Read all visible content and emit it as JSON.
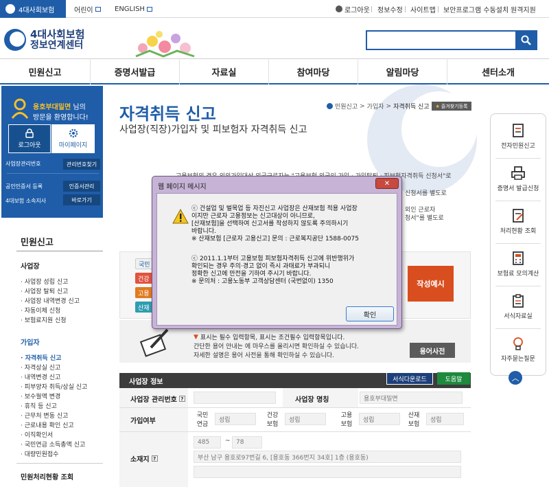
{
  "topbar": {
    "active_tab": "4대사회보험",
    "tabs": [
      "어린이",
      "ENGLISH"
    ],
    "links": [
      "로그아웃",
      "정보수정",
      "사이트맵",
      "보안프로그램 수동설치",
      "원격지원"
    ]
  },
  "header": {
    "logo_line1": "4대사회보험",
    "logo_line2": "정보연계센터",
    "search_placeholder": ""
  },
  "nav": [
    "민원신고",
    "증명서발급",
    "자료실",
    "참여마당",
    "알림마당",
    "센터소개"
  ],
  "sidebar": {
    "greeting_name": "용호부대밀면",
    "greeting_suffix": "님의",
    "greeting_line2": "방문을 환영합니다!",
    "logout_label": "로그아웃",
    "mypage_label": "마이페이지",
    "rows": [
      {
        "label": "사업장관리번호",
        "button": "관리번호찾기"
      },
      {
        "label": "공인인증서 등록",
        "button": "인증서관리"
      },
      {
        "label": "4대보험 소속지사",
        "button": "바로가기"
      }
    ],
    "menu_title": "민원신고",
    "groups": [
      {
        "title": "사업장",
        "items": [
          "사업장 성립 신고",
          "사업장 탈퇴 신고",
          "사업장 내역변경 신고",
          "자동이체 신청",
          "보험료지원 신청"
        ]
      },
      {
        "title": "가입자",
        "items": [
          "자격취득 신고",
          "자격상실 신고",
          "내역변경 신고",
          "피부양자 취득/상실 신고",
          "보수월액 변경",
          "휴직 등 신고",
          "근무처 변동 신고",
          "근로내용 확인 신고",
          "이직확인서",
          "국민연금 소득총액 신고",
          "대량민원접수"
        ]
      }
    ],
    "bottom_title": "민원처리현황 조회"
  },
  "main": {
    "title": "자격취득 신고",
    "subtitle": "사업장(직장)가입자 및 피보험자 자격취득 신고",
    "breadcrumb": [
      "민원신고",
      "가입자",
      "자격취득 신고"
    ],
    "favorite_label": "즐겨찾기등록",
    "bg_text": [
      "고용보험의 경우 외의가입대상 외국근로자는 \"고용보험 외국인 가입 · 가입탈퇴 · 피보험자격취득 신청서\"로",
      "신청서를 별도로",
      "외인 근로자",
      "청서\"를 별도로"
    ],
    "tags": [
      "국민",
      "건강",
      "고용",
      "산재"
    ],
    "example_button": "작성예시",
    "help_text": [
      "표시는 필수 입력항목, 표시는 조건필수 입력항목입니다.",
      "간단한 용어 안내는 에 마우스를 올리시면 확인하실 수 있습니다.",
      "자세한 설명은 용어 사전을 통해 확인하실 수 있습니다."
    ],
    "dictionary_button": "용어사전"
  },
  "form": {
    "section_title": "사업장 정보",
    "download_button": "서식다운로드",
    "help_button": "도움말",
    "mgmt_no_label": "사업장 관리번호",
    "name_label": "사업장 명칭",
    "name_value": "용호부대밀면",
    "join_label": "가입여부",
    "insurances": [
      {
        "name": "국민\n연금",
        "value": "성립"
      },
      {
        "name": "건강\n보험",
        "value": "성립"
      },
      {
        "name": "고용\n보험",
        "value": "성립"
      },
      {
        "name": "산재\n보험",
        "value": "성립"
      }
    ],
    "address_label": "소재지",
    "zip1": "485",
    "zip2": "78",
    "address": "부산 남구 용호로97번길 6, [용호동 366번지 34호] 1층 (용호동)"
  },
  "quick_menu": [
    "전자민원신고",
    "증명서 발급신청",
    "처리현황 조회",
    "보험료 모의계산",
    "서식자료실",
    "자주묻는질문"
  ],
  "dialog": {
    "title": "웹 페이지 메시지",
    "paragraph1": [
      "ⓒ 건설업 및 벌목업 등 자진신고 사업장은 산재보험 적용 사업장",
      "이지만 근로자 고용정보는 신고대상이 아니므로,",
      "[산재보험]을 선택하여 신고서를 작성하지 않도록 주의하시기",
      "바랍니다.",
      "※ 산재보험 [근로자 고용신고] 문의 : 근로복지공단 1588-0075"
    ],
    "paragraph2": [
      "ⓒ 2011.1.1부터 고용보험 피보험자격취득 신고에 위반행위가",
      "확인되는 경우 주의·경고 없이 즉시 과태료가 부과되니",
      "정확한 신고에 만전을 기하여 주시기 바랍니다.",
      "※ 문의처 : 고용노동부 고객상담센터 (국번없이) 1350"
    ],
    "ok_label": "확인"
  }
}
